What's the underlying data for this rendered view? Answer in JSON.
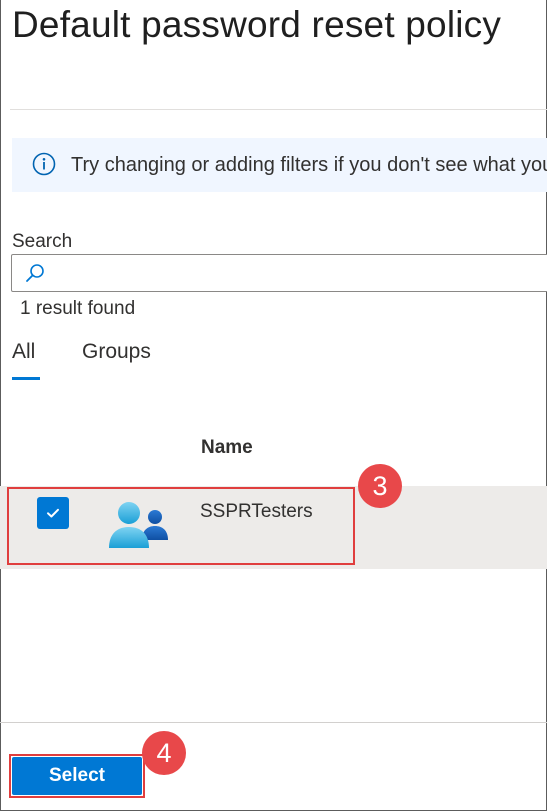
{
  "panel": {
    "title": "Default password reset policy"
  },
  "info_bar": {
    "icon": "info-icon",
    "text": "Try changing or adding filters if you don't see what you're looking for."
  },
  "search": {
    "label": "Search",
    "value": "",
    "placeholder": "",
    "icon": "search-icon"
  },
  "result_count": "1 result found",
  "tabs": [
    {
      "label": "All",
      "selected": true
    },
    {
      "label": "Groups",
      "selected": false
    }
  ],
  "table": {
    "columns": [
      "Name"
    ],
    "rows": [
      {
        "name": "SSPRTesters",
        "selected": true,
        "icon": "group-icon"
      }
    ]
  },
  "annotations": {
    "step_3": "3",
    "step_4": "4"
  },
  "footer": {
    "select_label": "Select"
  },
  "colors": {
    "accent": "#0078d4",
    "callout": "#e8484a",
    "info_background": "#f0f6ff",
    "selected_row": "#edebe9"
  }
}
